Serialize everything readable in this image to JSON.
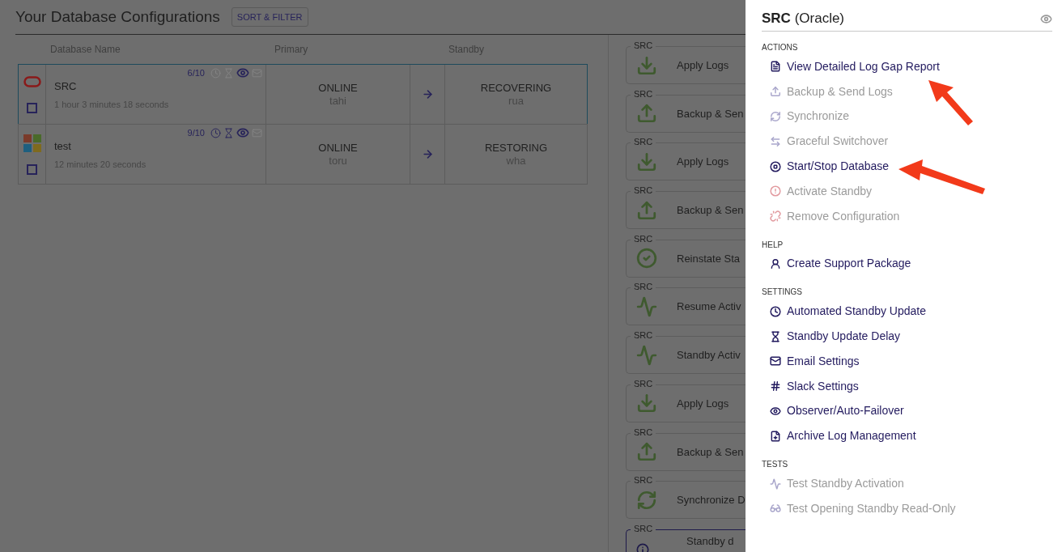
{
  "main": {
    "title": "Your Database Configurations",
    "sort_button": "SORT & FILTER",
    "table": {
      "columns": [
        "Database Name",
        "Primary",
        "Standby"
      ],
      "rows": [
        {
          "selected": true,
          "checked": false,
          "kind": "oracle",
          "name": "SRC",
          "duration": "1 hour 3 minutes 18 seconds",
          "score": "6/10",
          "indicators": [
            {
              "kind": "clock",
              "on": false
            },
            {
              "kind": "hourglass",
              "on": false
            },
            {
              "kind": "eye",
              "on": true
            },
            {
              "kind": "mail",
              "on": false
            }
          ],
          "primary_status": "ONLINE",
          "primary_host": "tahi",
          "standby_status": "RECOVERING",
          "standby_host": "rua"
        },
        {
          "selected": false,
          "checked": false,
          "kind": "microsoft",
          "name": "test",
          "duration": "12 minutes 20 seconds",
          "score": "9/10",
          "indicators": [
            {
              "kind": "clock",
              "on": true
            },
            {
              "kind": "hourglass",
              "on": true
            },
            {
              "kind": "eye",
              "on": true
            },
            {
              "kind": "mail",
              "on": false
            }
          ],
          "primary_status": "ONLINE",
          "primary_host": "toru",
          "standby_status": "RESTORING",
          "standby_host": "wha"
        }
      ]
    },
    "activity": [
      {
        "kind": "download",
        "tag": "SRC",
        "label": "Apply Logs"
      },
      {
        "kind": "upload",
        "tag": "SRC",
        "label": "Backup & Sen"
      },
      {
        "kind": "download",
        "tag": "SRC",
        "label": "Apply Logs"
      },
      {
        "kind": "upload",
        "tag": "SRC",
        "label": "Backup & Sen"
      },
      {
        "kind": "check",
        "tag": "SRC",
        "label": "Reinstate Sta"
      },
      {
        "kind": "pulse",
        "tag": "SRC",
        "label": "Resume Activ"
      },
      {
        "kind": "pulse",
        "tag": "SRC",
        "label": "Standby Activ"
      },
      {
        "kind": "download",
        "tag": "SRC",
        "label": "Apply Logs"
      },
      {
        "kind": "upload",
        "tag": "SRC",
        "label": "Backup & Sen"
      },
      {
        "kind": "sync",
        "tag": "SRC",
        "label": "Synchronize D"
      },
      {
        "kind": "info",
        "tag": "SRC",
        "label": "Standby d"
      }
    ]
  },
  "drawer": {
    "title": "**SRC** (Oracle)",
    "sections": [
      {
        "heading": "ACTIONS",
        "items": [
          {
            "kind": "report",
            "label": "View Detailed Log Gap Report",
            "disabled": false
          },
          {
            "kind": "upload",
            "label": "Backup & Send Logs",
            "disabled": true
          },
          {
            "kind": "sync",
            "label": "Synchronize",
            "disabled": true
          },
          {
            "kind": "swap",
            "label": "Graceful Switchover",
            "disabled": true
          },
          {
            "kind": "stop",
            "label": "Start/Stop Database",
            "disabled": false
          },
          {
            "kind": "alert",
            "label": "Activate Standby",
            "disabled": true
          },
          {
            "kind": "unlink",
            "label": "Remove Configuration",
            "disabled": true
          }
        ]
      },
      {
        "heading": "HELP",
        "items": [
          {
            "kind": "support",
            "label": "Create Support Package",
            "disabled": false
          }
        ]
      },
      {
        "heading": "SETTINGS",
        "items": [
          {
            "kind": "clock",
            "label": "Automated Standby Update",
            "disabled": false
          },
          {
            "kind": "hourglass",
            "label": "Standby Update Delay",
            "disabled": false
          },
          {
            "kind": "mail",
            "label": "Email Settings",
            "disabled": false
          },
          {
            "kind": "hash",
            "label": "Slack Settings",
            "disabled": false
          },
          {
            "kind": "eye",
            "label": "Observer/Auto-Failover",
            "disabled": false
          },
          {
            "kind": "archive",
            "label": "Archive Log Management",
            "disabled": false
          }
        ]
      },
      {
        "heading": "TESTS",
        "items": [
          {
            "kind": "pulse",
            "label": "Test Standby Activation",
            "disabled": true
          },
          {
            "kind": "glasses",
            "label": "Test Opening Standby Read-Only",
            "disabled": true
          }
        ]
      }
    ]
  }
}
